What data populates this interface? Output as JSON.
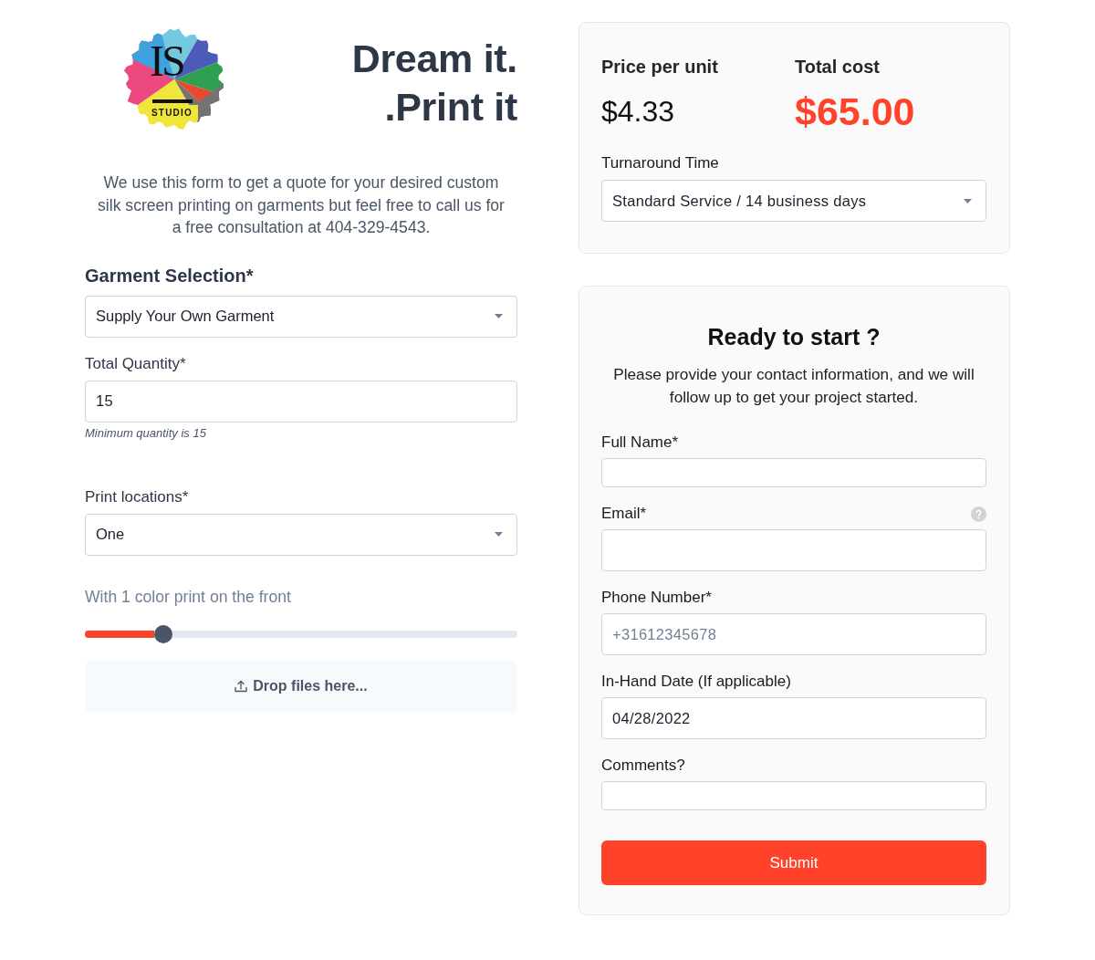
{
  "logo": {
    "monogram": "IS",
    "wordmark": "STUDIO"
  },
  "headline": [
    "Dream it.",
    ".Print it"
  ],
  "intro": "We use this form to get a quote for your desired custom silk screen printing on garments but feel free to call us for a free consultation at 404-329-4543.",
  "garment_selection": {
    "label": "Garment Selection*",
    "value": "Supply Your Own Garment"
  },
  "total_quantity": {
    "label": "Total Quantity*",
    "value": "15",
    "hint": "Minimum quantity is 15"
  },
  "print_locations": {
    "label": "Print locations*",
    "value": "One"
  },
  "colors": {
    "caption": "With 1 color print on the front",
    "level": 0.16
  },
  "dropzone": {
    "label": "Drop files here..."
  },
  "pricing": {
    "price_per_unit": {
      "label": "Price per unit",
      "value": "$4.33"
    },
    "total_cost": {
      "label": "Total cost",
      "value": "$65.00"
    },
    "turnaround": {
      "label": "Turnaround Time",
      "value": "Standard Service / 14 business days"
    }
  },
  "contact": {
    "title": "Ready to start ?",
    "description": "Please provide your contact information, and we will follow up to get your project started.",
    "fields": [
      {
        "kind": "text",
        "label": "Full Name*"
      },
      {
        "kind": "email",
        "label": "Email*"
      },
      {
        "kind": "tel",
        "label": "Phone Number*",
        "placeholder": "+31612345678"
      },
      {
        "kind": "date",
        "label": "In-Hand Date (If applicable)",
        "value": "04/28/2022"
      },
      {
        "kind": "textarea",
        "label": "Comments?"
      }
    ],
    "submit": "Submit"
  }
}
